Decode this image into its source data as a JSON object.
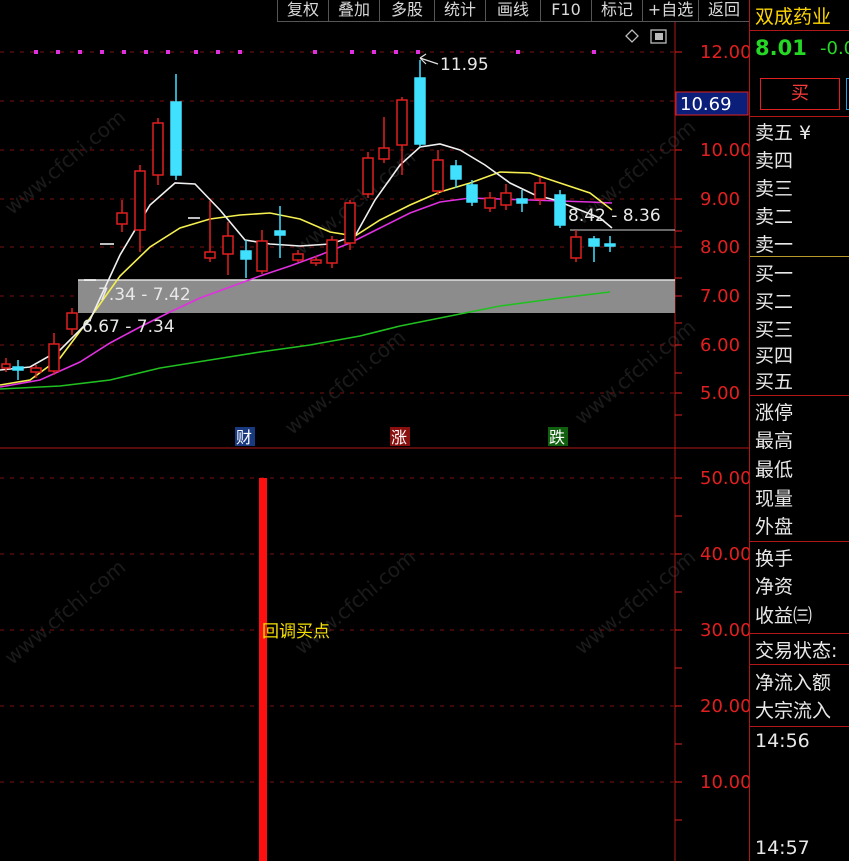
{
  "toolbar": {
    "buttons": [
      "复权",
      "叠加",
      "多股",
      "统计",
      "画线",
      "F10",
      "标记",
      "+自选",
      "返回"
    ]
  },
  "chart_data": {
    "type": "candlestick",
    "y_ticks": [
      "12.00",
      "11.00",
      "10.00",
      "9.00",
      "8.00",
      "7.00",
      "6.00",
      "5.00"
    ],
    "current_price_label": "10.69",
    "annotations": {
      "peak": "11.95",
      "range1": "7.34 - 7.42",
      "range2": "6.67 - 7.34",
      "range3": "8.42 - 8.36"
    },
    "event_markers": [
      "财",
      "涨",
      "跌"
    ],
    "indicator_ticks": [
      "50.00",
      "40.00",
      "30.00",
      "20.00",
      "10.00"
    ],
    "indicator_label": "回调买点",
    "indicator_bar_value": 50
  },
  "panel": {
    "stock_name": "双成药业",
    "price": "8.01",
    "change": "-0.0",
    "buy_button": "买",
    "sell_levels": [
      "卖五 ¥",
      "卖四",
      "卖三",
      "卖二",
      "卖一"
    ],
    "buy_levels": [
      "买一",
      "买二",
      "买三",
      "买四",
      "买五"
    ],
    "stats1": [
      "涨停",
      "最高",
      "最低",
      "现量",
      "外盘"
    ],
    "stats2": [
      "换手",
      "净资",
      "收益㈢"
    ],
    "trade_status": "交易状态:",
    "flows": [
      "净流入额",
      "大宗流入"
    ],
    "time1": "14:56",
    "time2": "14:57"
  },
  "colors": {
    "up": "#e02020",
    "down": "#40e0ff",
    "ma_white": "#f0f0f0",
    "ma_yellow": "#f5f050",
    "ma_magenta": "#e030e0",
    "ma_green": "#20c020",
    "accent_gold": "#ffd700",
    "fall_green": "#26d826"
  },
  "watermark": "www.cfchi.com"
}
